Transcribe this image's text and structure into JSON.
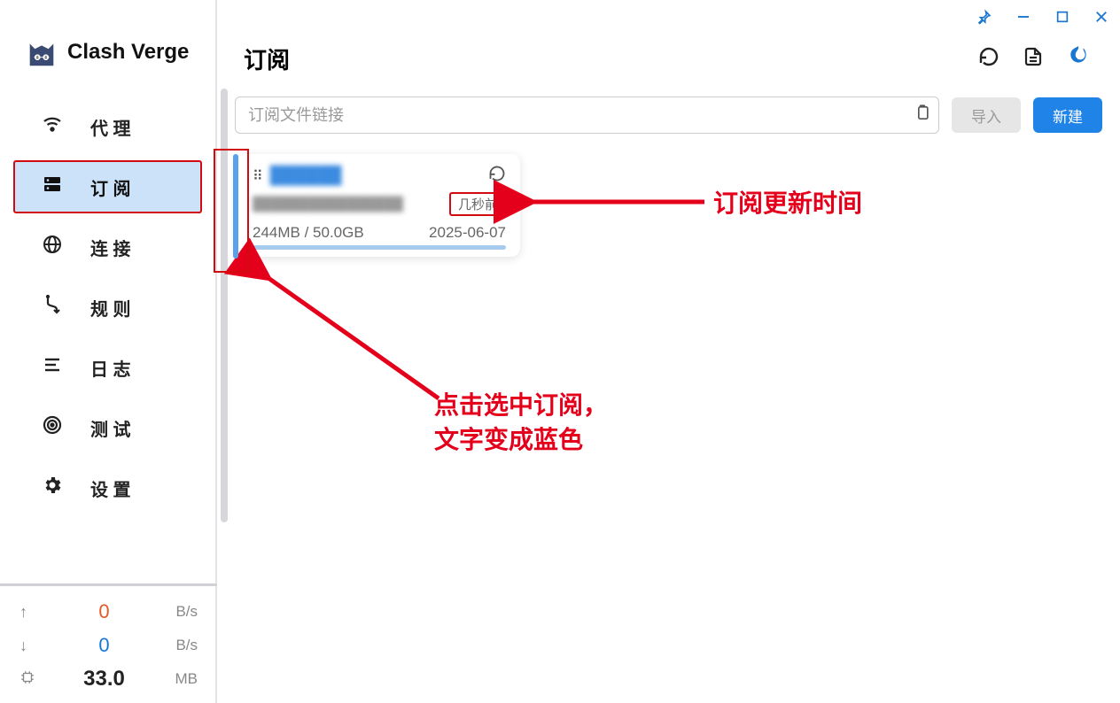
{
  "app": {
    "name": "Clash Verge"
  },
  "nav": {
    "items": [
      {
        "label": "代 理"
      },
      {
        "label": "订 阅"
      },
      {
        "label": "连 接"
      },
      {
        "label": "规 则"
      },
      {
        "label": "日 志"
      },
      {
        "label": "测 试"
      },
      {
        "label": "设 置"
      }
    ],
    "activeIndex": 1
  },
  "stats": {
    "up_value": "0",
    "up_unit": "B/s",
    "down_value": "0",
    "down_unit": "B/s",
    "mem_value": "33.0",
    "mem_unit": "MB"
  },
  "page": {
    "title": "订阅",
    "url_placeholder": "订阅文件链接",
    "import_label": "导入",
    "new_label": "新建"
  },
  "profile": {
    "name_blurred": "██████",
    "host_blurred": "████████████████",
    "update_time": "几秒前",
    "used": "244MB",
    "total": "50.0GB",
    "date": "2025-06-07",
    "used_total": "244MB / 50.0GB"
  },
  "annotations": {
    "time_label": "订阅更新时间",
    "select_label_line1": "点击选中订阅，",
    "select_label_line2": "文字变成蓝色"
  }
}
